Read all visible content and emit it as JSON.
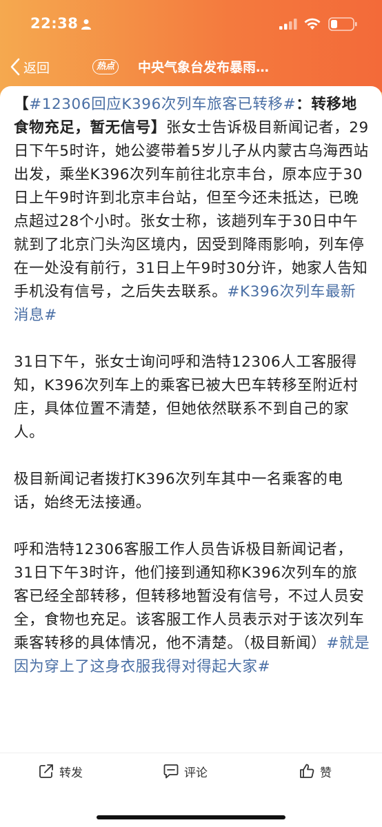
{
  "status_bar": {
    "time": "22:38"
  },
  "nav": {
    "back_label": "返回",
    "badge": "热点",
    "title": "中央气象台发布暴雨…"
  },
  "post": {
    "p1": {
      "open": "【",
      "topic": "#12306回应K396次列车旅客已转移#",
      "title_rest": "：转移地食物充足，暂无信号",
      "close": "】",
      "body": "张女士告诉极目新闻记者，29日下午5时许，她公婆带着5岁儿子从内蒙古乌海西站出发，乘坐K396次列车前往北京丰台，原本应于30日上午9时许到北京丰台站，但至今还未抵达，已晚点超过28个小时。张女士称，该趟列车于30日中午就到了北京门头沟区境内，因受到降雨影响，列车停在一处没有前行，31日上午9时30分许，她家人告知手机没有信号，之后失去联系。",
      "tail_topic": "#K396次列车最新消息#"
    },
    "p2": "31日下午，张女士询问呼和浩特12306人工客服得知，K396次列车上的乘客已被大巴车转移至附近村庄，具体位置不清楚，但她依然联系不到自己的家人。",
    "p3": "极目新闻记者拨打K396次列车其中一名乘客的电话，始终无法接通。",
    "p4": {
      "body": "呼和浩特12306客服工作人员告诉极目新闻记者，31日下午3时许，他们接到通知称K396次列车的旅客已经全部转移，但转移地暂没有信号，不过人员安全，食物也充足。该客服工作人员表示对于该次列车乘客转移的具体情况，他不清楚。（极目新闻）",
      "tail_topic": "#就是因为穿上了这身衣服我得对得起大家#"
    }
  },
  "actions": {
    "share": "转发",
    "comment": "评论",
    "like": "赞"
  },
  "colors": {
    "header_start": "#f5a94f",
    "header_end": "#f36a39",
    "topic": "#4a6fa5"
  },
  "icons": [
    "person-icon",
    "signal-icon",
    "wifi-icon",
    "battery-icon",
    "back-chevron-icon",
    "share-icon",
    "comment-icon",
    "like-icon"
  ]
}
